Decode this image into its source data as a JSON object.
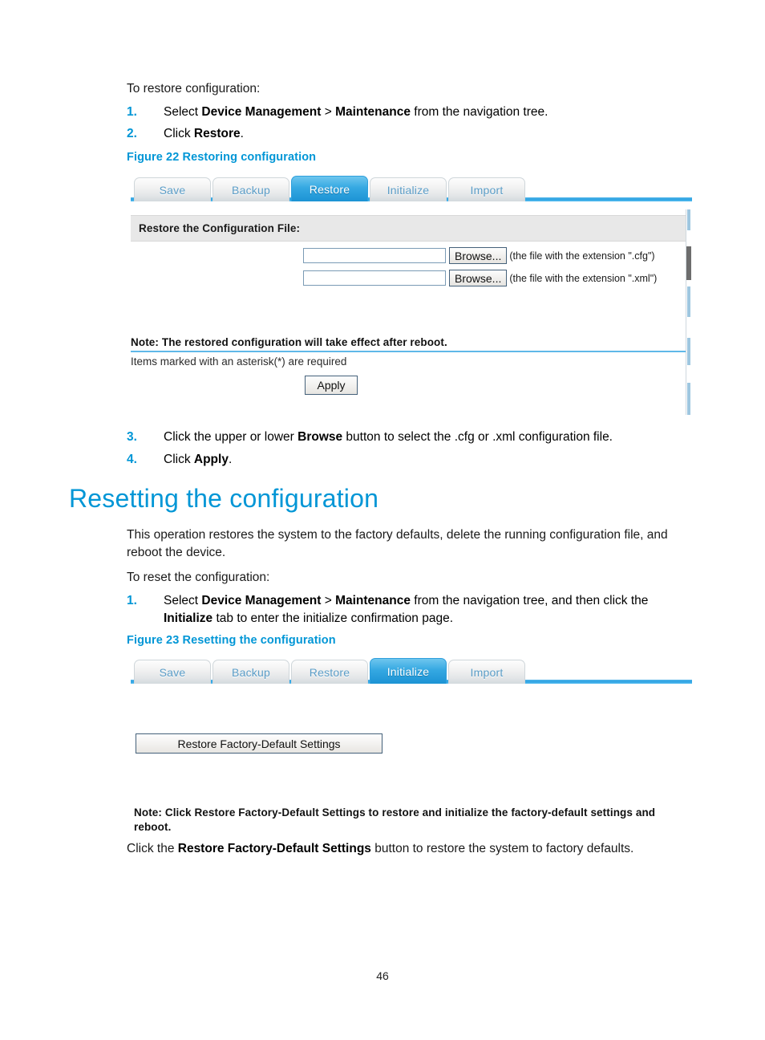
{
  "document": {
    "page_number": "46"
  },
  "section_restore": {
    "lead_in": "To restore configuration:",
    "steps": [
      {
        "num": "1.",
        "pre": "Select ",
        "bold1": "Device Management",
        "mid": " > ",
        "bold2": "Maintenance",
        "post": " from the navigation tree."
      },
      {
        "num": "2.",
        "pre": "Click ",
        "bold1": "Restore",
        "post": "."
      }
    ],
    "figure_caption": "Figure 22 Restoring configuration",
    "steps_after": [
      {
        "num": "3.",
        "pre": "Click the upper or lower ",
        "bold1": "Browse",
        "post": " button to select the .cfg or .xml configuration file."
      },
      {
        "num": "4.",
        "pre": "Click ",
        "bold1": "Apply",
        "post": "."
      }
    ]
  },
  "figure22": {
    "tabs": [
      {
        "label": "Save",
        "active": false
      },
      {
        "label": "Backup",
        "active": false
      },
      {
        "label": "Restore",
        "active": true
      },
      {
        "label": "Initialize",
        "active": false
      },
      {
        "label": "Import",
        "active": false
      }
    ],
    "section_header": "Restore the Configuration File:",
    "rows": [
      {
        "input_value": "",
        "button_label": "Browse...",
        "hint": "(the file with the extension \".cfg\")"
      },
      {
        "input_value": "",
        "button_label": "Browse...",
        "hint": "(the file with the extension \".xml\")"
      }
    ],
    "note": "Note: The restored configuration will take effect after reboot.",
    "required_note": "Items marked with an asterisk(*) are required",
    "apply_label": "Apply"
  },
  "section_reset": {
    "heading": "Resetting the configuration",
    "paragraph": "This operation restores the system to the factory defaults, delete the running configuration file, and reboot the device.",
    "lead_in": "To reset the configuration:",
    "step": {
      "num": "1.",
      "pre": "Select ",
      "bold1": "Device Management",
      "mid": " > ",
      "bold2": "Maintenance",
      "post": " from the navigation tree, and then click the ",
      "bold3": "Initialize",
      "post2": " tab to enter the initialize confirmation page."
    },
    "figure_caption": "Figure 23 Resetting the configuration",
    "closing": {
      "pre": "Click the ",
      "bold1": "Restore Factory-Default Settings",
      "post": " button to restore the system to factory defaults."
    }
  },
  "figure23": {
    "tabs": [
      {
        "label": "Save",
        "active": false
      },
      {
        "label": "Backup",
        "active": false
      },
      {
        "label": "Restore",
        "active": false
      },
      {
        "label": "Initialize",
        "active": true
      },
      {
        "label": "Import",
        "active": false
      }
    ],
    "factory_button_label": "Restore Factory-Default Settings",
    "note": "Note: Click Restore Factory-Default Settings to restore and initialize the factory-default settings and reboot."
  },
  "colors": {
    "accent_blue": "#0096d6",
    "tab_active_blue": "#1c93d4",
    "rule_blue": "#5fb8e8"
  }
}
